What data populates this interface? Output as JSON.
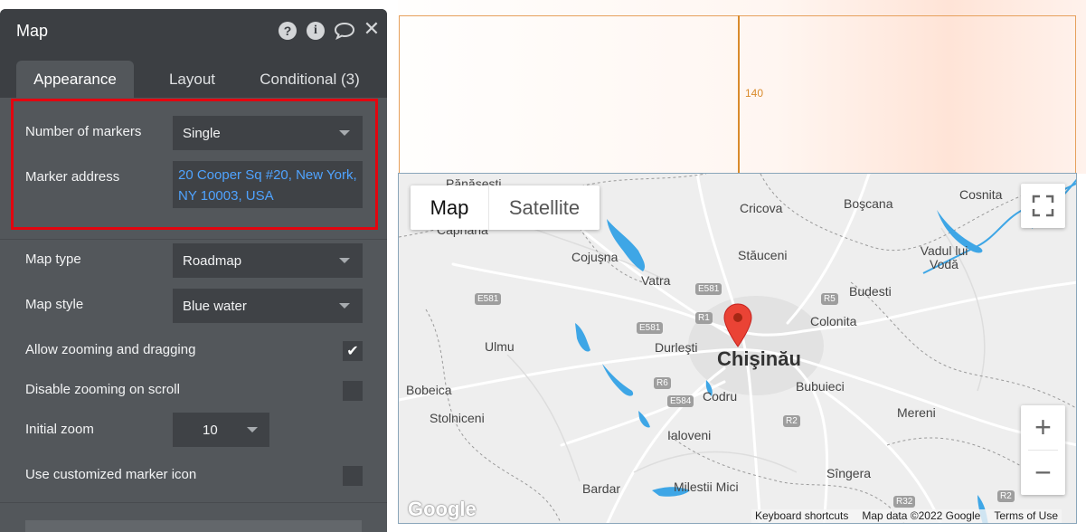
{
  "panel": {
    "title": "Map",
    "tabs": [
      "Appearance",
      "Layout",
      "Conditional (3)"
    ],
    "fields": {
      "number_of_markers": {
        "label": "Number of markers",
        "value": "Single"
      },
      "marker_address": {
        "label": "Marker address",
        "value": "20 Cooper Sq #20, New York, NY 10003, USA"
      },
      "map_type": {
        "label": "Map type",
        "value": "Roadmap"
      },
      "map_style": {
        "label": "Map style",
        "value": "Blue water"
      },
      "allow_zoom": {
        "label": "Allow zooming and dragging",
        "checked": true
      },
      "disable_scroll_zoom": {
        "label": "Disable zooming on scroll",
        "checked": false
      },
      "initial_zoom": {
        "label": "Initial zoom",
        "value": "10"
      },
      "custom_marker": {
        "label": "Use customized marker icon",
        "checked": false
      }
    }
  },
  "canvas": {
    "dimension_label": "140"
  },
  "map": {
    "type_buttons": [
      "Map",
      "Satellite"
    ],
    "places": [
      "Pănăşeşti",
      "Cricova",
      "Boşcana",
      "Cosnita",
      "Căpriana",
      "Stăuceni",
      "Vadul lui Vodă",
      "Cojuşna",
      "Vatra",
      "Budesti",
      "Colonita",
      "Ulmu",
      "Durleşti",
      "Chişinău",
      "Bobeica",
      "Codru",
      "Bubuieci",
      "Stolniceni",
      "Mereni",
      "Ialoveni",
      "Sîngera",
      "Bardar",
      "Milestii Mici"
    ],
    "road_shields": [
      "E581",
      "E581",
      "E581",
      "R1",
      "R5",
      "R6",
      "E584",
      "R2",
      "R32",
      "R2"
    ],
    "attribution": {
      "logo": "Google",
      "shortcuts": "Keyboard shortcuts",
      "data": "Map data ©2022 Google",
      "terms": "Terms of Use"
    }
  },
  "colors": {
    "panel_bg": "#53575b",
    "highlight_border": "#e3050f",
    "link_blue": "#4fa3ff",
    "water_blue": "#3ea6e6",
    "marker_red": "#ea4335"
  }
}
